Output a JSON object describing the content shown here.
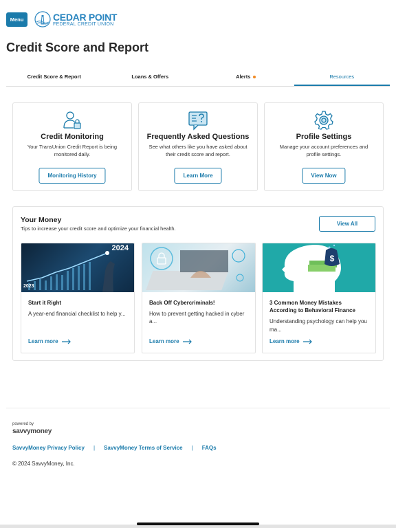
{
  "header": {
    "menu_label": "Menu",
    "logo_line1": "CEDAR POINT",
    "logo_line2": "FEDERAL CREDIT UNION"
  },
  "page_title": "Credit Score and Report",
  "tabs": [
    {
      "label": "Credit Score & Report"
    },
    {
      "label": "Loans & Offers"
    },
    {
      "label": "Alerts"
    },
    {
      "label": "Resources"
    }
  ],
  "colors": {
    "accent": "#1b7bab",
    "alert_dot": "#f08a24"
  },
  "cards": [
    {
      "icon": "credit-monitoring-icon",
      "title": "Credit Monitoring",
      "desc": "Your TransUnion Credit Report is being monitored daily.",
      "button": "Monitoring History"
    },
    {
      "icon": "faq-icon",
      "title": "Frequently Asked Questions",
      "desc": "See what others like you have asked about their credit score and report.",
      "button": "Learn More"
    },
    {
      "icon": "gear-icon",
      "title": "Profile Settings",
      "desc": "Manage your account preferences and profile settings.",
      "button": "View Now"
    }
  ],
  "your_money": {
    "title": "Your Money",
    "subtitle": "Tips to increase your credit score and optimize your financial health.",
    "view_all": "View All",
    "articles": [
      {
        "title": "Start it Right",
        "excerpt": "A year-end financial checklist to help y...",
        "more": "Learn more",
        "img_label_top": "2024",
        "img_label_bottom": "2023"
      },
      {
        "title": "Back Off Cybercriminals!",
        "excerpt": "How to prevent getting hacked in cyber a...",
        "more": "Learn more"
      },
      {
        "title": "3 Common Money Mistakes According to Behavioral Finance",
        "excerpt": "Understanding psychology can help you ma...",
        "more": "Learn more"
      }
    ]
  },
  "footer": {
    "powered_by": "powered by",
    "brand": "savvymoney",
    "links": [
      "SavvyMoney Privacy Policy",
      "SavvyMoney Terms of Service",
      "FAQs"
    ],
    "separator": "|",
    "copyright": "© 2024 SavvyMoney, Inc."
  }
}
